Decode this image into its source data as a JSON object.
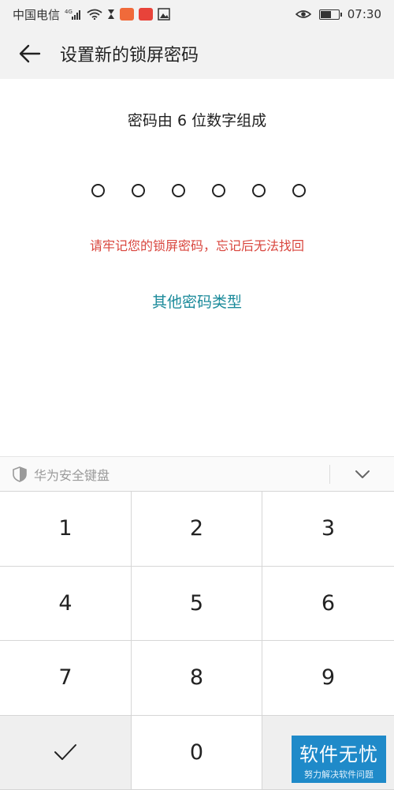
{
  "status_bar": {
    "carrier": "中国电信",
    "network": "4G",
    "time": "07:30",
    "battery_level": 0.6
  },
  "header": {
    "title": "设置新的锁屏密码"
  },
  "main": {
    "hint": "密码由 6 位数字组成",
    "dot_count": 6,
    "warning": "请牢记您的锁屏密码，忘记后无法找回",
    "other_types_link": "其他密码类型"
  },
  "keyboard": {
    "label": "华为安全键盘",
    "keys": [
      "1",
      "2",
      "3",
      "4",
      "5",
      "6",
      "7",
      "8",
      "9",
      "",
      "0",
      ""
    ]
  },
  "watermark": {
    "main": "软件无忧",
    "sub": "努力解决软件问题"
  },
  "colors": {
    "accent_link": "#1c8b9b",
    "warning": "#d9463e",
    "watermark_bg": "#1f8ac9"
  }
}
